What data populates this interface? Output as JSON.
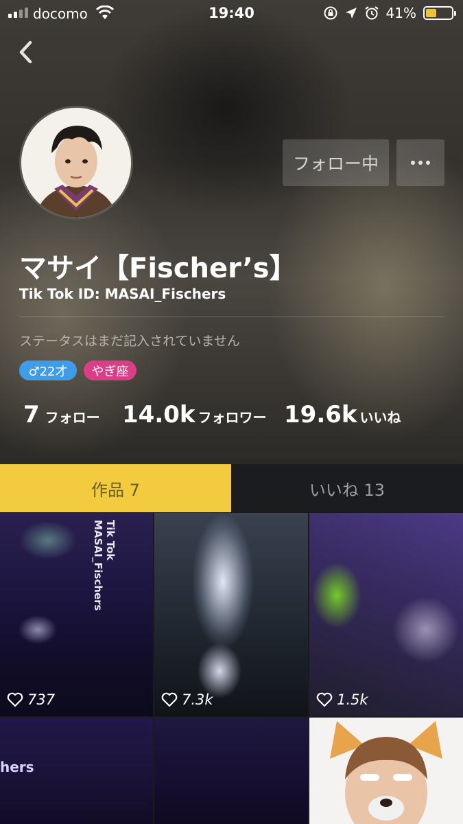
{
  "status_bar": {
    "carrier": "docomo",
    "time": "19:40",
    "battery": "41%",
    "battery_level": 0.41,
    "icons": [
      "signal-icon",
      "wifi-icon",
      "rotation-lock-icon",
      "location-icon",
      "alarm-icon",
      "battery-icon"
    ]
  },
  "profile": {
    "follow_button": "フォロー中",
    "display_name": "マサイ【Fischer’s】",
    "tiktok_id": "Tik Tok ID: MASAI_Fischers",
    "status": "ステータスはまだ記入されていません",
    "tags": {
      "gender": "♂22才",
      "zodiac": "やぎ座"
    },
    "stats": {
      "following_count": "7",
      "following_label": "フォロー",
      "followers_count": "14.0k",
      "followers_label": "フォロワー",
      "likes_count": "19.6k",
      "likes_label": "いいね"
    }
  },
  "tabs": {
    "works": "作品 7",
    "likes": "いいね 13"
  },
  "videos": [
    {
      "likes": "737",
      "overlay": "Tik Tok\nMASAI_Fischers"
    },
    {
      "likes": "7.3k"
    },
    {
      "likes": "1.5k"
    },
    {
      "overlay": "hers"
    },
    {},
    {}
  ],
  "colors": {
    "tab_active": "#f2cc3e",
    "tab_inactive": "#1b1c20",
    "tag_gender": "#3f9ce8",
    "tag_zodiac": "#d93e86",
    "battery": "#f0c330"
  }
}
